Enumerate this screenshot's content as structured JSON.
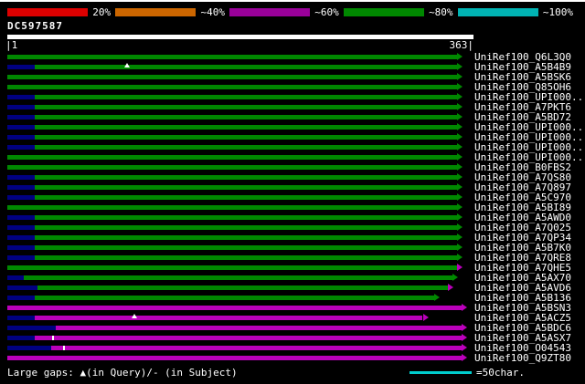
{
  "chart_data": {
    "type": "bar",
    "orientation": "horizontal",
    "title": "DC597587",
    "x_range": [
      1,
      363
    ],
    "axis_left_label": "|1",
    "axis_right_label": "363|",
    "identity_scale": {
      "stops": [
        {
          "name": "red",
          "color": "#dd0000",
          "label": "20%"
        },
        {
          "name": "orange",
          "color": "#cc6600",
          "label": "~40%"
        },
        {
          "name": "purple",
          "color": "#990099",
          "label": "~60%"
        },
        {
          "name": "green",
          "color": "#008800",
          "label": "~80%"
        },
        {
          "name": "cyan",
          "color": "#00b3b3",
          "label": "~100%"
        }
      ]
    },
    "colors": {
      "green": "#008800",
      "magenta": "#bb00bb",
      "navy": "#000080"
    },
    "rows": [
      {
        "label": "UniRef100_Q6L3Q0",
        "segments": [
          {
            "s": 0,
            "e": 97.5,
            "c": "green"
          }
        ],
        "arrow": "green",
        "markers": []
      },
      {
        "label": "UniRef100_A5B4B9",
        "segments": [
          {
            "s": 0,
            "e": 5.9,
            "c": "navy"
          },
          {
            "s": 5.9,
            "e": 97.5,
            "c": "green"
          }
        ],
        "arrow": "green",
        "markers": [
          {
            "x": 26,
            "t": "gap"
          }
        ]
      },
      {
        "label": "UniRef100_A5BSK6",
        "segments": [
          {
            "s": 0,
            "e": 97.5,
            "c": "green"
          }
        ],
        "arrow": "green",
        "markers": []
      },
      {
        "label": "UniRef100_Q85OH6",
        "segments": [
          {
            "s": 0,
            "e": 97.5,
            "c": "green"
          }
        ],
        "arrow": "green",
        "markers": []
      },
      {
        "label": "UniRef100_UPI000..",
        "segments": [
          {
            "s": 0,
            "e": 5.9,
            "c": "navy"
          },
          {
            "s": 5.9,
            "e": 97.5,
            "c": "green"
          }
        ],
        "arrow": "green",
        "markers": []
      },
      {
        "label": "UniRef100_A7PKT6",
        "segments": [
          {
            "s": 0,
            "e": 5.9,
            "c": "navy"
          },
          {
            "s": 5.9,
            "e": 97.5,
            "c": "green"
          }
        ],
        "arrow": "green",
        "markers": []
      },
      {
        "label": "UniRef100_A5BD72",
        "segments": [
          {
            "s": 0,
            "e": 5.9,
            "c": "navy"
          },
          {
            "s": 5.9,
            "e": 97.5,
            "c": "green"
          }
        ],
        "arrow": "green",
        "markers": []
      },
      {
        "label": "UniRef100_UPI000..",
        "segments": [
          {
            "s": 0,
            "e": 5.9,
            "c": "navy"
          },
          {
            "s": 5.9,
            "e": 97.5,
            "c": "green"
          }
        ],
        "arrow": "green",
        "markers": []
      },
      {
        "label": "UniRef100_UPI000..",
        "segments": [
          {
            "s": 0,
            "e": 5.9,
            "c": "navy"
          },
          {
            "s": 5.9,
            "e": 97.5,
            "c": "green"
          }
        ],
        "arrow": "green",
        "markers": []
      },
      {
        "label": "UniRef100_UPI000..",
        "segments": [
          {
            "s": 0,
            "e": 5.9,
            "c": "navy"
          },
          {
            "s": 5.9,
            "e": 97.5,
            "c": "green"
          }
        ],
        "arrow": "green",
        "markers": []
      },
      {
        "label": "UniRef100_UPI000..",
        "segments": [
          {
            "s": 0,
            "e": 97.5,
            "c": "green"
          }
        ],
        "arrow": "green",
        "markers": []
      },
      {
        "label": "UniRef100_B0FBS2",
        "segments": [
          {
            "s": 0,
            "e": 97.5,
            "c": "green"
          }
        ],
        "arrow": "green",
        "markers": []
      },
      {
        "label": "UniRef100_A7QS80",
        "segments": [
          {
            "s": 0,
            "e": 5.9,
            "c": "navy"
          },
          {
            "s": 5.9,
            "e": 97.5,
            "c": "green"
          }
        ],
        "arrow": "green",
        "markers": []
      },
      {
        "label": "UniRef100_A7Q897",
        "segments": [
          {
            "s": 0,
            "e": 5.9,
            "c": "navy"
          },
          {
            "s": 5.9,
            "e": 97.5,
            "c": "green"
          }
        ],
        "arrow": "green",
        "markers": []
      },
      {
        "label": "UniRef100_A5C970",
        "segments": [
          {
            "s": 0,
            "e": 5.9,
            "c": "navy"
          },
          {
            "s": 5.9,
            "e": 97.5,
            "c": "green"
          }
        ],
        "arrow": "green",
        "markers": []
      },
      {
        "label": "UniRef100_A5BI89",
        "segments": [
          {
            "s": 0,
            "e": 97.5,
            "c": "green"
          }
        ],
        "arrow": "green",
        "markers": []
      },
      {
        "label": "UniRef100_A5AWD0",
        "segments": [
          {
            "s": 0,
            "e": 5.9,
            "c": "navy"
          },
          {
            "s": 5.9,
            "e": 97.5,
            "c": "green"
          }
        ],
        "arrow": "green",
        "markers": []
      },
      {
        "label": "UniRef100_A7Q025",
        "segments": [
          {
            "s": 0,
            "e": 5.9,
            "c": "navy"
          },
          {
            "s": 5.9,
            "e": 97.5,
            "c": "green"
          }
        ],
        "arrow": "green",
        "markers": []
      },
      {
        "label": "UniRef100_A7QP34",
        "segments": [
          {
            "s": 0,
            "e": 5.9,
            "c": "navy"
          },
          {
            "s": 5.9,
            "e": 97.5,
            "c": "green"
          }
        ],
        "arrow": "green",
        "markers": []
      },
      {
        "label": "UniRef100_A5B7K0",
        "segments": [
          {
            "s": 0,
            "e": 5.9,
            "c": "navy"
          },
          {
            "s": 5.9,
            "e": 97.5,
            "c": "green"
          }
        ],
        "arrow": "green",
        "markers": []
      },
      {
        "label": "UniRef100_A7QRE8",
        "segments": [
          {
            "s": 0,
            "e": 5.9,
            "c": "navy"
          },
          {
            "s": 5.9,
            "e": 97.5,
            "c": "green"
          }
        ],
        "arrow": "green",
        "markers": []
      },
      {
        "label": "UniRef100_A7QHE5",
        "segments": [
          {
            "s": 0,
            "e": 97.5,
            "c": "green"
          }
        ],
        "arrow": "magenta",
        "markers": []
      },
      {
        "label": "UniRef100_A5AX70",
        "segments": [
          {
            "s": 0,
            "e": 3.5,
            "c": "navy"
          },
          {
            "s": 3.5,
            "e": 96.5,
            "c": "green"
          }
        ],
        "arrow": "green",
        "markers": []
      },
      {
        "label": "UniRef100_A5AVD6",
        "segments": [
          {
            "s": 0,
            "e": 6.5,
            "c": "navy"
          },
          {
            "s": 6.5,
            "e": 95.5,
            "c": "green"
          }
        ],
        "arrow": "magenta",
        "markers": []
      },
      {
        "label": "UniRef100_A5B136",
        "segments": [
          {
            "s": 0,
            "e": 5.9,
            "c": "navy"
          },
          {
            "s": 5.9,
            "e": 92.5,
            "c": "green"
          }
        ],
        "arrow": "green",
        "markers": []
      },
      {
        "label": "UniRef100_A5BSN3",
        "segments": [
          {
            "s": 0,
            "e": 98.5,
            "c": "magenta"
          }
        ],
        "arrow": "magenta",
        "markers": []
      },
      {
        "label": "UniRef100_A5ACZ5",
        "segments": [
          {
            "s": 0,
            "e": 5.9,
            "c": "navy"
          },
          {
            "s": 5.9,
            "e": 90,
            "c": "magenta"
          }
        ],
        "arrow": "magenta",
        "markers": [
          {
            "x": 27.5,
            "t": "gap"
          }
        ]
      },
      {
        "label": "UniRef100_A5BDC6",
        "segments": [
          {
            "s": 0,
            "e": 10.5,
            "c": "navy"
          },
          {
            "s": 10.5,
            "e": 98.5,
            "c": "magenta"
          }
        ],
        "arrow": "magenta",
        "markers": []
      },
      {
        "label": "UniRef100_A5ASX7",
        "segments": [
          {
            "s": 0,
            "e": 5.9,
            "c": "navy"
          },
          {
            "s": 5.9,
            "e": 98.5,
            "c": "magenta"
          }
        ],
        "arrow": "magenta",
        "markers": [
          {
            "x": 9.8,
            "t": "tick"
          }
        ]
      },
      {
        "label": "UniRef100_O04543",
        "segments": [
          {
            "s": 0,
            "e": 9.5,
            "c": "navy"
          },
          {
            "s": 9.5,
            "e": 98.5,
            "c": "magenta"
          }
        ],
        "arrow": "magenta",
        "markers": [
          {
            "x": 12,
            "t": "tick"
          }
        ]
      },
      {
        "label": "UniRef100_Q9ZT80",
        "segments": [
          {
            "s": 0,
            "e": 98.5,
            "c": "magenta"
          }
        ],
        "arrow": "magenta",
        "markers": []
      }
    ],
    "legend": {
      "gaps_text": "Large gaps: ▲(in Query)/- (in Subject)",
      "unit_text": "=50char.",
      "unit_color": "#00cccc"
    }
  }
}
